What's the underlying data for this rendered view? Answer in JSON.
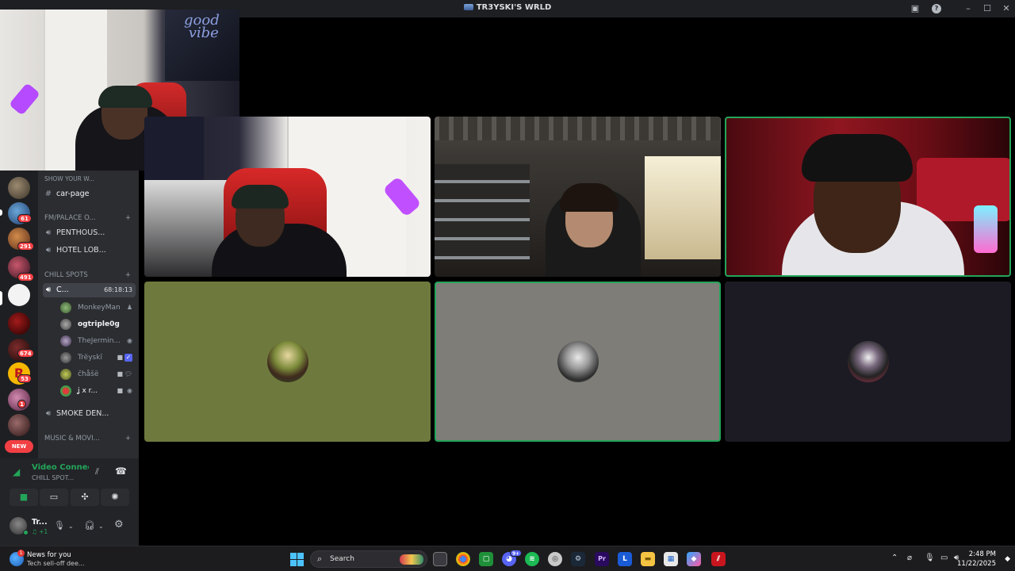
{
  "window": {
    "title": "TR3YSKI'S WRLD"
  },
  "rail": {
    "badges": [
      "61",
      "291",
      "491",
      "674",
      "53",
      "1"
    ],
    "new_label": "NEW"
  },
  "channels": {
    "partial_top": "SHOW YOUR W...",
    "text_channel": "car-page",
    "category_fm": "FM/PALACE O...",
    "voice_penthouse": "PENTHOUS...",
    "voice_hotel": "HOTEL LOB...",
    "category_chill": "CHILL SPOTS",
    "active_channel": "C...",
    "active_timer": "68:18:13",
    "users": [
      {
        "name": "MonkeyMan"
      },
      {
        "name": "ogtriple0g"
      },
      {
        "name": "TheJermin..."
      },
      {
        "name": "Trëyskī"
      },
      {
        "name": "čhåšë"
      },
      {
        "name": "ʝ x r..."
      }
    ],
    "voice_smoke": "SMOKE DEN...",
    "category_music": "MUSIC & MOVI..."
  },
  "voice_panel": {
    "status": "Video Connected",
    "channel": "CHILL SPOT...",
    "user_name": "Tr...",
    "user_sub": "♫ +1"
  },
  "taskbar": {
    "news_title": "News for you",
    "news_sub": "Tech sell-off dee...",
    "news_badge": "1",
    "search_label": "Search",
    "discord_badge": "9+",
    "time": "2:48 PM",
    "date": "11/22/2025"
  },
  "colors": {
    "speaking": "#23a559",
    "tile_green": "#6e7a3d",
    "tile_grey": "#7e7d78",
    "tile_dark": "#1c1b24"
  }
}
